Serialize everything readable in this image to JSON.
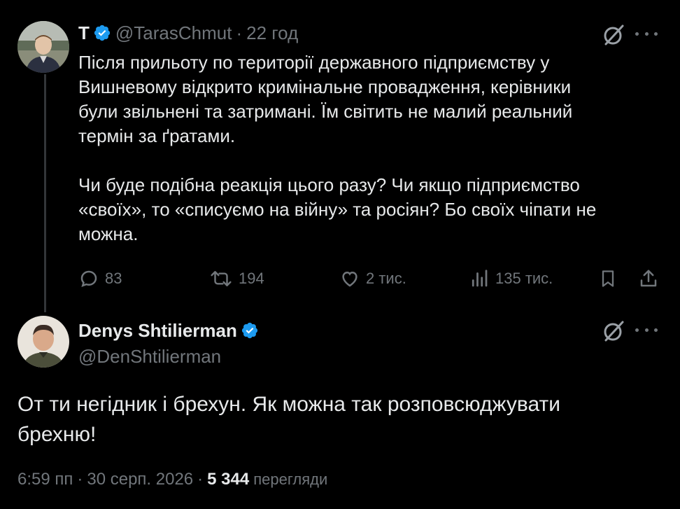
{
  "tweet1": {
    "author_name": "T",
    "handle": "@TarasChmut",
    "time": "22 год",
    "verified": true,
    "body_lines": [
      "Після прильоту по території державного підприємству у",
      "Вишневому відкрито кримінальне провадження, керівники",
      "були звільнені та затримані. Їм світить не малий реальний",
      "термін за ґратами.",
      "",
      "Чи буде подібна реакція цього разу? Чи якщо підприємство",
      "«своїх», то «списуємо на війну» та росіян? Бо своїх чіпати не",
      "можна."
    ],
    "actions": {
      "replies": "83",
      "reposts": "194",
      "likes": "2 тис.",
      "views": "135 тис."
    }
  },
  "tweet2": {
    "author_name": "Denys Shtilierman",
    "handle": "@DenShtilierman",
    "verified": true,
    "body_lines": [
      "От ти негідник і брехун. Як можна так розповсюджувати",
      "брехню!"
    ],
    "time": "6:59 пп",
    "date": "30 серп. 2026",
    "views_count": "5 344",
    "views_label": "перегляди"
  },
  "colors": {
    "background": "#000000",
    "text": "#e7e9ea",
    "muted": "#71767b",
    "verified": "#1d9bf0",
    "thread_line": "#333639"
  },
  "icons": [
    "grok-icon",
    "more-icon",
    "reply-icon",
    "repost-icon",
    "like-icon",
    "views-icon",
    "bookmark-icon",
    "share-icon",
    "verified-badge-icon"
  ]
}
